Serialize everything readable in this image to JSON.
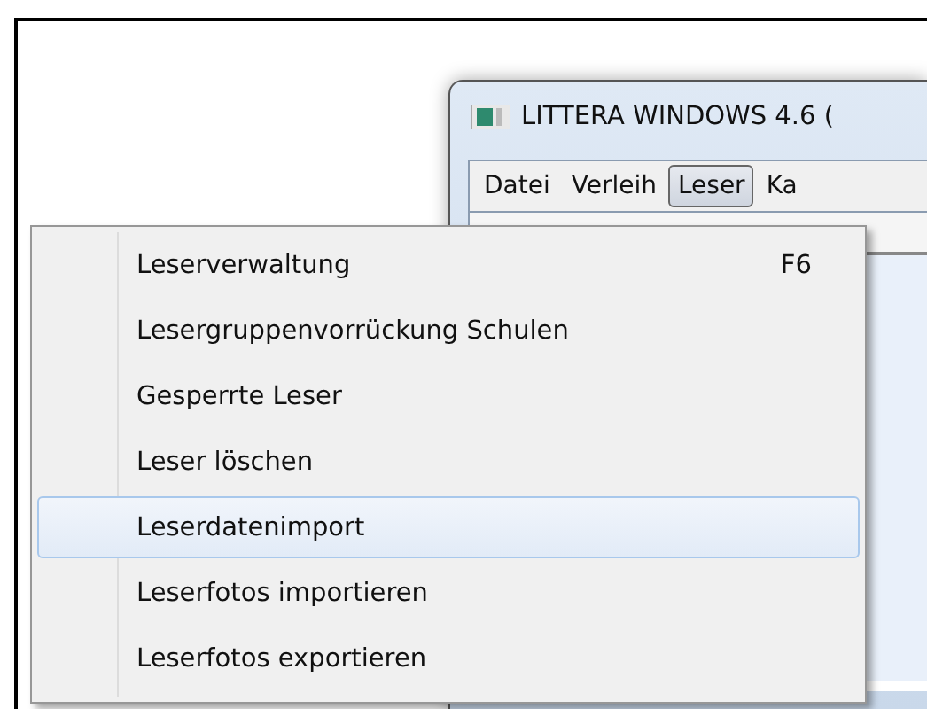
{
  "window": {
    "title": "LITTERA WINDOWS 4.6 ("
  },
  "menu_bar": [
    {
      "label": "Datei",
      "selected": false
    },
    {
      "label": "Verleih",
      "selected": false
    },
    {
      "label": "Leser",
      "selected": true
    },
    {
      "label": "Ka",
      "selected": false
    }
  ],
  "menu": [
    {
      "label": "Leserverwaltung",
      "shortcut": "F6",
      "selected": false
    },
    {
      "label": "Lesergruppenvorrückung Schulen",
      "selected": false
    },
    {
      "label": "Gesperrte Leser",
      "selected": false
    },
    {
      "label": "Leser löschen",
      "selected": false
    },
    {
      "label": "Leserdatenimport",
      "selected": true
    },
    {
      "label": "Leserfotos importieren",
      "selected": false
    },
    {
      "label": "Leserfotos exportieren",
      "selected": false
    }
  ]
}
